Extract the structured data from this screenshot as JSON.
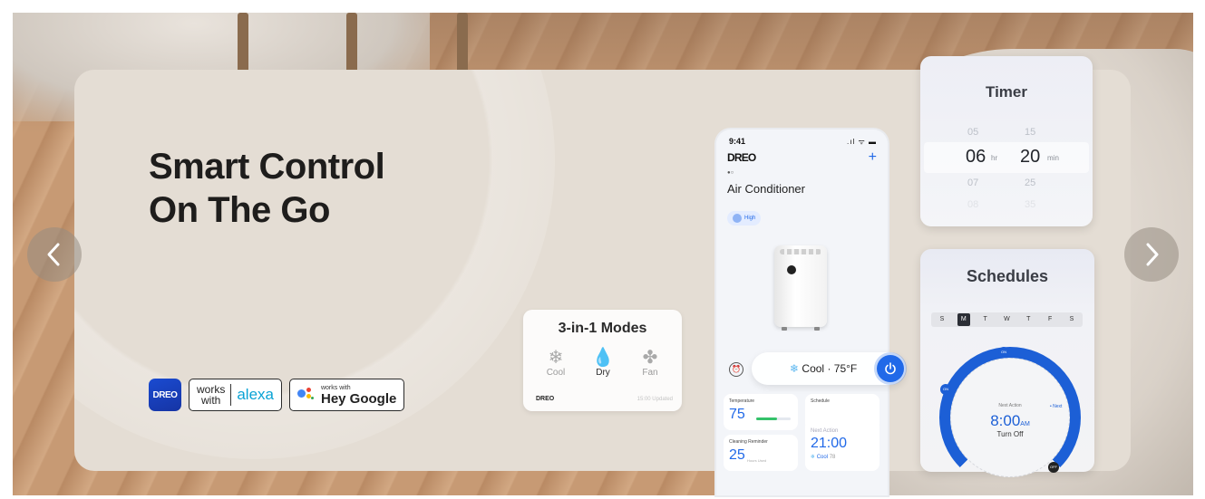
{
  "hero": {
    "title_line1": "Smart Control",
    "title_line2": "On The Go"
  },
  "badges": {
    "app_brand": "DREO",
    "alexa_works": "works",
    "alexa_with": "with",
    "alexa_word": "alexa",
    "google_small": "works with",
    "google_big": "Hey Google"
  },
  "nav": {
    "prev_icon": "chevron-left-icon",
    "next_icon": "chevron-right-icon"
  },
  "modes_card": {
    "title": "3-in-1 Modes",
    "modes": [
      {
        "label": "Cool",
        "icon": "snowflake-icon",
        "active": false
      },
      {
        "label": "Dry",
        "icon": "droplet-slash-icon",
        "active": true
      },
      {
        "label": "Fan",
        "icon": "fan-icon",
        "active": false
      }
    ],
    "brand": "DREO",
    "updated": "15:00 Updated"
  },
  "phone": {
    "time": "9:41",
    "status": ".ıl ᯤ ▬",
    "brand": "DREO",
    "plus": "+",
    "device_name": "Air Conditioner",
    "fan_chip": "High",
    "cool_mode": "Cool",
    "temp_setting": "· 75°F",
    "temperature_label": "Temperature",
    "temperature_value": "75",
    "schedule_label": "Schedule",
    "cleaning_label": "Cleaning Reminder",
    "cleaning_value": "25",
    "cleaning_unit": "Hours Used",
    "next_action_label": "Next Action",
    "next_action_time": "21:00",
    "next_action_mode": "Cool",
    "next_action_temp": "78"
  },
  "timer": {
    "title": "Timer",
    "hours_above": "05",
    "hours": "06",
    "hours_below": "07",
    "hours_far": "08",
    "hr_unit": "hr",
    "mins_above": "15",
    "mins": "20",
    "mins_below": "25",
    "mins_far": "35",
    "min_unit": "min"
  },
  "schedules": {
    "title": "Schedules",
    "days": [
      "S",
      "M",
      "T",
      "W",
      "T",
      "F",
      "S"
    ],
    "selected_day_index": 1,
    "next_action_label": "Next Action",
    "time": "8:00",
    "ampm": "AM",
    "action": "Turn Off",
    "on_label": "ON",
    "off_label": "OFF",
    "next_tag": "• Next"
  },
  "colors": {
    "accent": "#2169e8",
    "dial": "#1c5fd6",
    "dry_active": "#f08a2c"
  }
}
